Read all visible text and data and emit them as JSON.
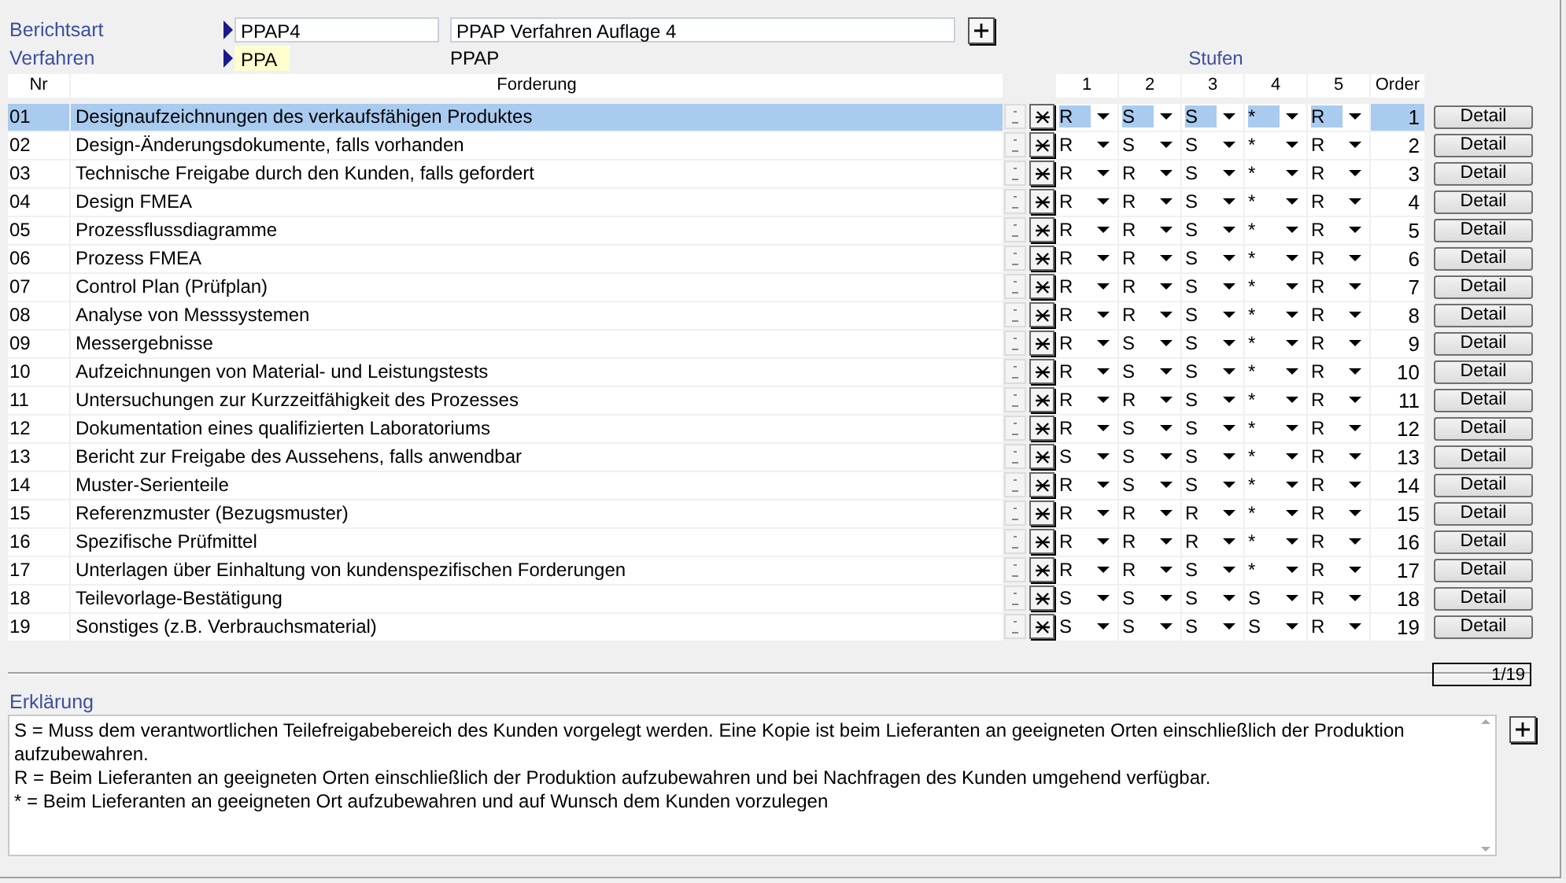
{
  "header": {
    "report_type_label": "Berichtsart",
    "report_type_code": "PPAP4",
    "report_type_name": "PPAP Verfahren Auflage 4",
    "procedure_label": "Verfahren",
    "procedure_code": "PPA",
    "procedure_name": "PPAP",
    "stages_label": "Stufen"
  },
  "table": {
    "columns": [
      "Nr",
      "Forderung",
      "1",
      "2",
      "3",
      "4",
      "5",
      "Order"
    ],
    "rows": [
      {
        "nr": "01",
        "text": "Designaufzeichnungen des verkaufsfähigen Produktes",
        "stages": [
          "R",
          "S",
          "S",
          "*",
          "R"
        ],
        "order": "1",
        "button": "Detail",
        "selected": true
      },
      {
        "nr": "02",
        "text": "Design-Änderungsdokumente, falls vorhanden",
        "stages": [
          "R",
          "S",
          "S",
          "*",
          "R"
        ],
        "order": "2",
        "button": "Detail",
        "selected": false
      },
      {
        "nr": "03",
        "text": "Technische Freigabe durch den Kunden, falls gefordert",
        "stages": [
          "R",
          "R",
          "S",
          "*",
          "R"
        ],
        "order": "3",
        "button": "Detail",
        "selected": false
      },
      {
        "nr": "04",
        "text": "Design FMEA",
        "stages": [
          "R",
          "R",
          "S",
          "*",
          "R"
        ],
        "order": "4",
        "button": "Detail",
        "selected": false
      },
      {
        "nr": "05",
        "text": "Prozessflussdiagramme",
        "stages": [
          "R",
          "R",
          "S",
          "*",
          "R"
        ],
        "order": "5",
        "button": "Detail",
        "selected": false
      },
      {
        "nr": "06",
        "text": "Prozess FMEA",
        "stages": [
          "R",
          "R",
          "S",
          "*",
          "R"
        ],
        "order": "6",
        "button": "Detail",
        "selected": false
      },
      {
        "nr": "07",
        "text": "Control Plan (Prüfplan)",
        "stages": [
          "R",
          "R",
          "S",
          "*",
          "R"
        ],
        "order": "7",
        "button": "Detail",
        "selected": false
      },
      {
        "nr": "08",
        "text": "Analyse von Messsystemen",
        "stages": [
          "R",
          "R",
          "S",
          "*",
          "R"
        ],
        "order": "8",
        "button": "Detail",
        "selected": false
      },
      {
        "nr": "09",
        "text": "Messergebnisse",
        "stages": [
          "R",
          "S",
          "S",
          "*",
          "R"
        ],
        "order": "9",
        "button": "Detail",
        "selected": false
      },
      {
        "nr": "10",
        "text": "Aufzeichnungen von Material- und Leistungstests",
        "stages": [
          "R",
          "S",
          "S",
          "*",
          "R"
        ],
        "order": "10",
        "button": "Detail",
        "selected": false
      },
      {
        "nr": "11",
        "text": "Untersuchungen zur Kurzzeitfähigkeit des Prozesses",
        "stages": [
          "R",
          "R",
          "S",
          "*",
          "R"
        ],
        "order": "11",
        "button": "Detail",
        "selected": false
      },
      {
        "nr": "12",
        "text": "Dokumentation eines qualifizierten Laboratoriums",
        "stages": [
          "R",
          "S",
          "S",
          "*",
          "R"
        ],
        "order": "12",
        "button": "Detail",
        "selected": false
      },
      {
        "nr": "13",
        "text": "Bericht zur Freigabe des Aussehens, falls anwendbar",
        "stages": [
          "S",
          "S",
          "S",
          "*",
          "R"
        ],
        "order": "13",
        "button": "Detail",
        "selected": false
      },
      {
        "nr": "14",
        "text": "Muster-Serienteile",
        "stages": [
          "R",
          "S",
          "S",
          "*",
          "R"
        ],
        "order": "14",
        "button": "Detail",
        "selected": false
      },
      {
        "nr": "15",
        "text": "Referenzmuster (Bezugsmuster)",
        "stages": [
          "R",
          "R",
          "R",
          "*",
          "R"
        ],
        "order": "15",
        "button": "Detail",
        "selected": false
      },
      {
        "nr": "16",
        "text": "Spezifische Prüfmittel",
        "stages": [
          "R",
          "R",
          "R",
          "*",
          "R"
        ],
        "order": "16",
        "button": "Detail",
        "selected": false
      },
      {
        "nr": "17",
        "text": "Unterlagen über Einhaltung von kundenspezifischen Forderungen",
        "stages": [
          "R",
          "R",
          "S",
          "*",
          "R"
        ],
        "order": "17",
        "button": "Detail",
        "selected": false
      },
      {
        "nr": "18",
        "text": "Teilevorlage-Bestätigung",
        "stages": [
          "S",
          "S",
          "S",
          "S",
          "R"
        ],
        "order": "18",
        "button": "Detail",
        "selected": false
      },
      {
        "nr": "19",
        "text": "Sonstiges (z.B. Verbrauchsmaterial)",
        "stages": [
          "S",
          "S",
          "S",
          "S",
          "R"
        ],
        "order": "19",
        "button": "Detail",
        "selected": false
      }
    ]
  },
  "record_counter": "1/19",
  "explanation": {
    "label": "Erklärung",
    "lines": [
      "S = Muss dem verantwortlichen Teilefreigabebereich des Kunden vorgelegt werden. Eine Kopie ist beim Lieferanten an geeigneten Orten einschließlich der Produktion aufzubewahren.",
      "R = Beim Lieferanten an geeigneten Orten einschließlich der Produktion aufzubewahren und bei Nachfragen des Kunden umgehend verfügbar.",
      "* = Beim Lieferanten an geeigneten Ort aufzubewahren und auf Wunsch dem Kunden vorzulegen"
    ]
  }
}
